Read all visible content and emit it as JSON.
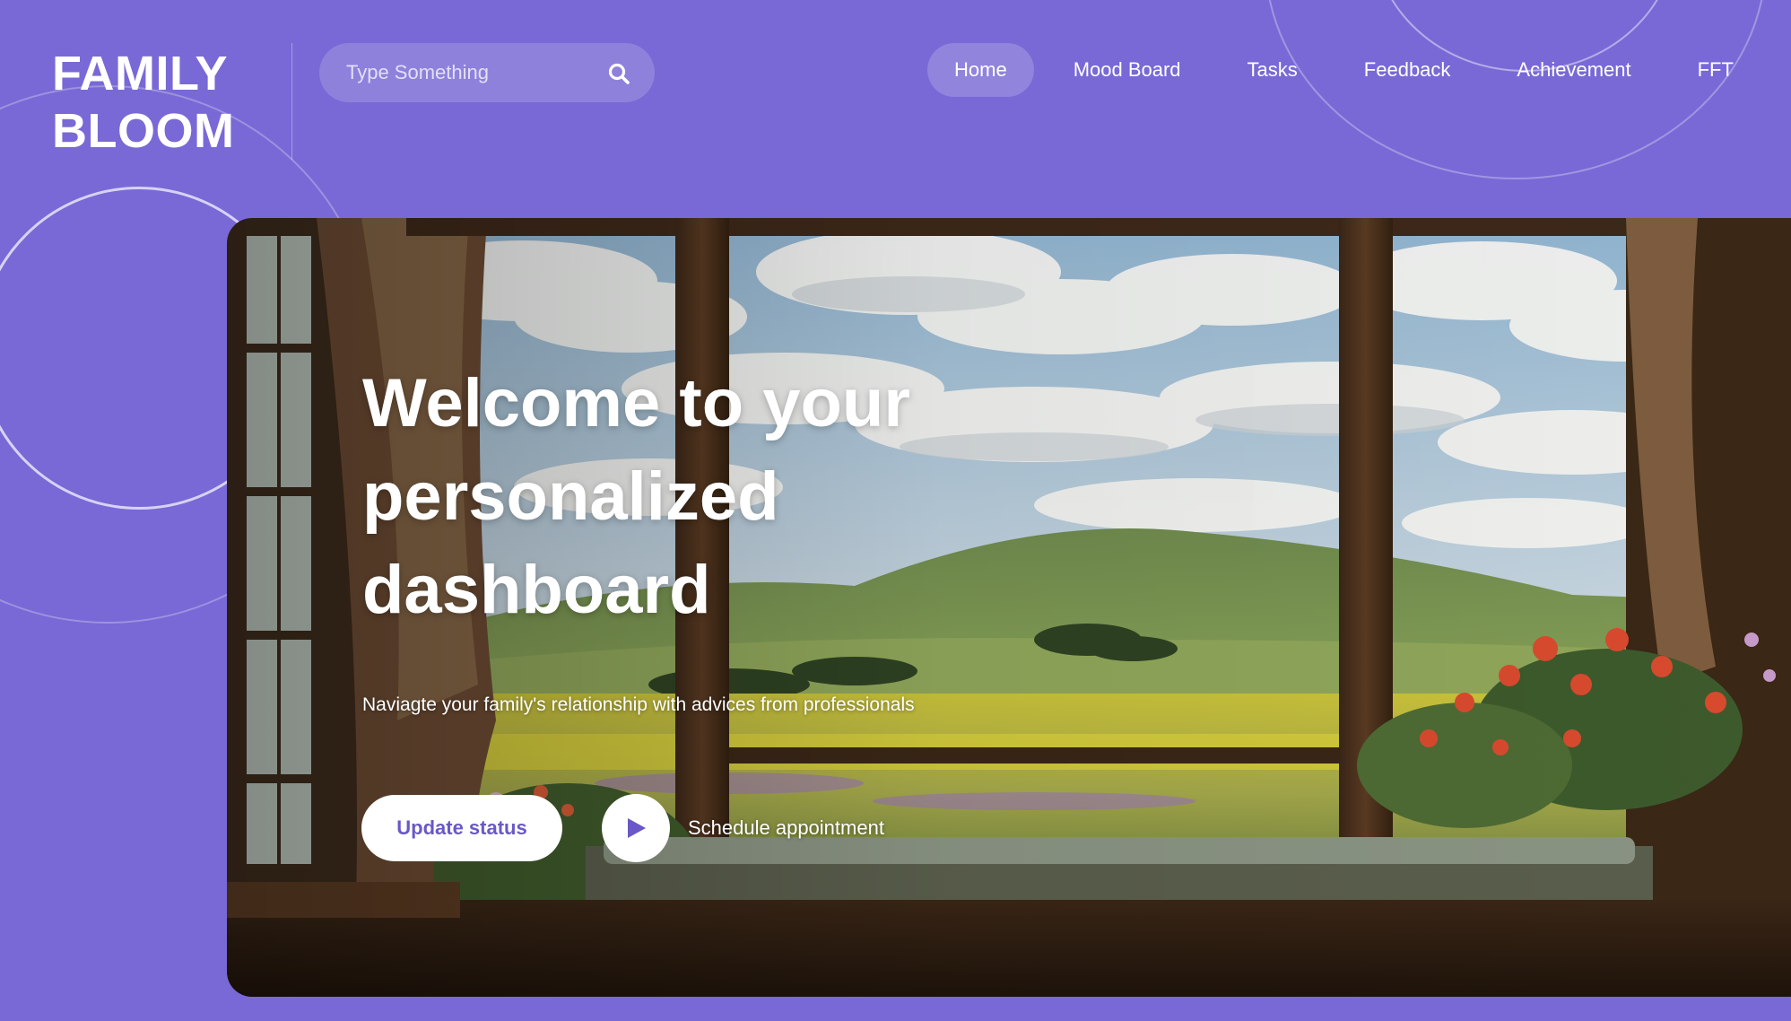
{
  "brand": {
    "line1": "FAMILY",
    "line2": "BLOOM"
  },
  "search": {
    "placeholder": "Type Something",
    "icon": "search-icon"
  },
  "nav": {
    "items": [
      {
        "label": "Home",
        "active": true
      },
      {
        "label": "Mood Board",
        "active": false
      },
      {
        "label": "Tasks",
        "active": false
      },
      {
        "label": "Feedback",
        "active": false
      },
      {
        "label": "Achievement",
        "active": false
      },
      {
        "label": "FFT",
        "active": false
      }
    ]
  },
  "hero": {
    "title": "Welcome to your personalized dashboard",
    "subtitle": "Naviagte your family's relationship with advices from professionals",
    "primary_button": "Update status",
    "play_icon": "play-icon",
    "secondary_link": "Schedule appointment"
  },
  "colors": {
    "background": "#7869d6",
    "accent_text": "#6a58c8",
    "white": "#ffffff"
  }
}
